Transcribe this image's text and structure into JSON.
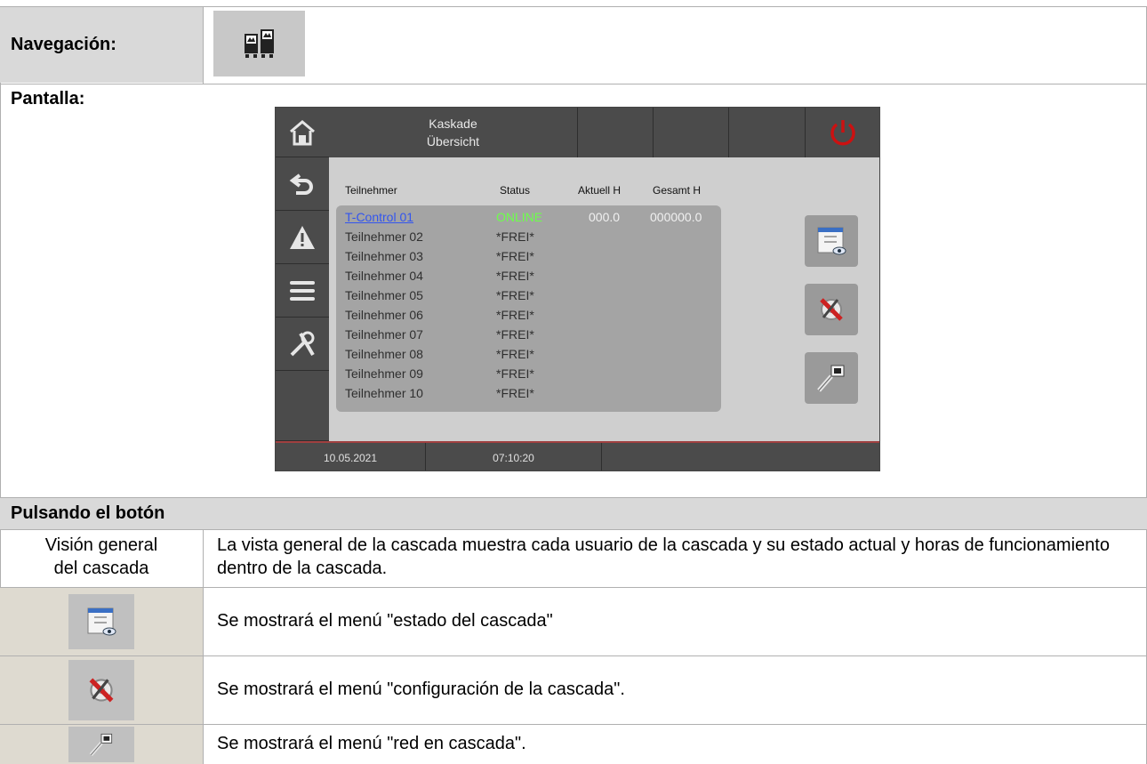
{
  "navigation": {
    "label": "Navegación:",
    "button_icon": "cascade-boilers-icon"
  },
  "screen": {
    "label": "Pantalla:"
  },
  "device": {
    "title_line1": "Kaskade",
    "title_line2": "Übersicht",
    "columns": [
      "Teilnehmer",
      "Status",
      "Aktuell H",
      "Gesamt H"
    ],
    "rows": [
      {
        "name": "T-Control 01",
        "status": "ONLINE",
        "aktuell": "000.0",
        "gesamt": "000000.0"
      },
      {
        "name": "Teilnehmer 02",
        "status": "*FREI*"
      },
      {
        "name": "Teilnehmer 03",
        "status": "*FREI*"
      },
      {
        "name": "Teilnehmer 04",
        "status": "*FREI*"
      },
      {
        "name": "Teilnehmer 05",
        "status": "*FREI*"
      },
      {
        "name": "Teilnehmer 06",
        "status": "*FREI*"
      },
      {
        "name": "Teilnehmer 07",
        "status": "*FREI*"
      },
      {
        "name": "Teilnehmer 08",
        "status": "*FREI*"
      },
      {
        "name": "Teilnehmer 09",
        "status": "*FREI*"
      },
      {
        "name": "Teilnehmer 10",
        "status": "*FREI*"
      }
    ],
    "date": "10.05.2021",
    "time": "07:10:20",
    "colors": {
      "online": "#6cff4a",
      "link": "#3355ee",
      "power": "#cc1111"
    }
  },
  "press": {
    "heading": "Pulsando el botón",
    "vision_label_line1": "Visión general",
    "vision_label_line2": "del cascada",
    "vision_desc": "La vista general de la cascada muestra cada usuario de la cascada y su estado actual y horas de funcionamiento dentro de la cascada.",
    "status_text": "Se mostrará el menú \"estado del cascada\"",
    "config_text": "Se mostrará el menú \"configuración de la cascada\".",
    "network_text": "Se mostrará el menú \"red en cascada\"."
  }
}
